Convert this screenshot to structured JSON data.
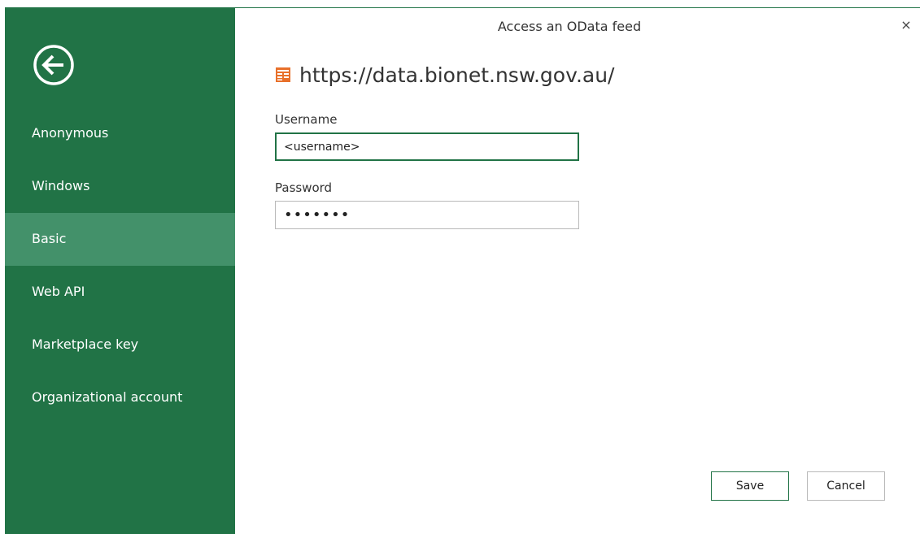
{
  "dialog": {
    "title": "Access an OData feed",
    "close_glyph": "×",
    "feed_url": "https://data.bionet.nsw.gov.au/"
  },
  "sidebar": {
    "items": [
      {
        "label": "Anonymous",
        "selected": false
      },
      {
        "label": "Windows",
        "selected": false
      },
      {
        "label": "Basic",
        "selected": true
      },
      {
        "label": "Web API",
        "selected": false
      },
      {
        "label": "Marketplace key",
        "selected": false
      },
      {
        "label": "Organizational account",
        "selected": false
      }
    ]
  },
  "form": {
    "username": {
      "label": "Username",
      "value": "<username>"
    },
    "password": {
      "label": "Password",
      "value": "•••••••"
    }
  },
  "buttons": {
    "save": "Save",
    "cancel": "Cancel"
  },
  "icons": {
    "back": "back-arrow-circle-icon",
    "feed": "odata-feed-icon",
    "close": "close-icon"
  },
  "colors": {
    "sidebar": "#217346",
    "sidebar_selected": "#43916a",
    "feed_icon": "#e8702a",
    "text": "#333333"
  }
}
